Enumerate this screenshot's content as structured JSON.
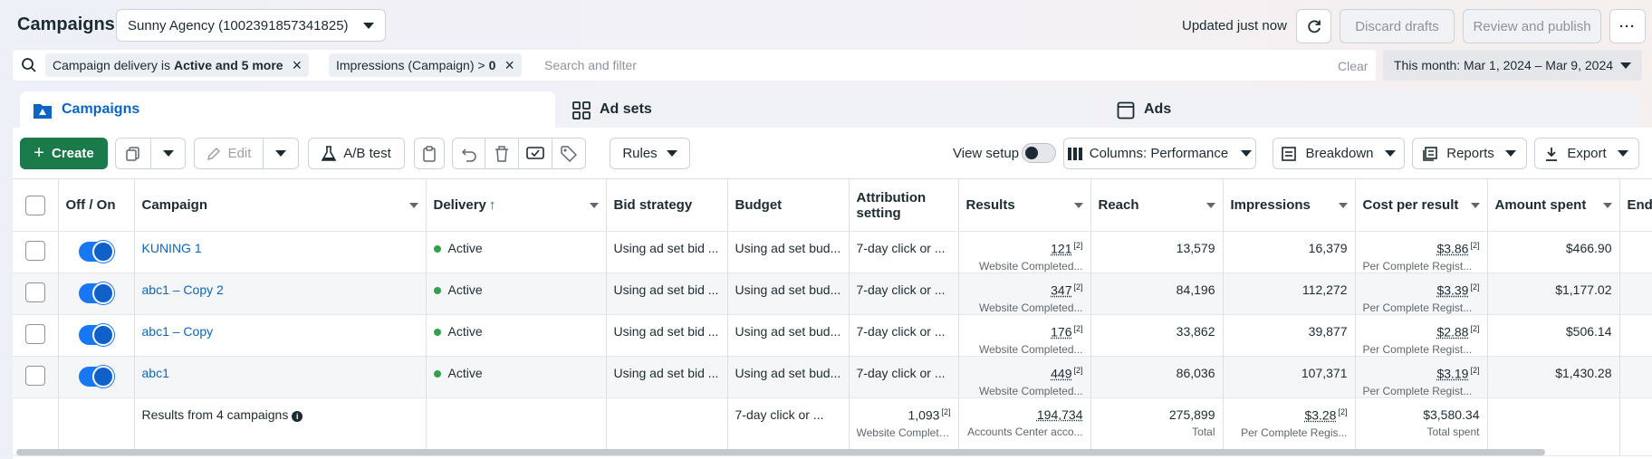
{
  "header": {
    "title": "Campaigns",
    "account": "Sunny Agency (1002391857341825)",
    "updated": "Updated just now",
    "discard": "Discard drafts",
    "review": "Review and publish",
    "more": "···"
  },
  "filters": {
    "chip1_prefix": "Campaign delivery is",
    "chip1_value": "Active and 5 more",
    "chip2_prefix": "Impressions (Campaign) >",
    "chip2_value": "0",
    "placeholder": "Search and filter",
    "clear": "Clear",
    "daterange": "This month: Mar 1, 2024 – Mar 9, 2024"
  },
  "tabs": [
    "Campaigns",
    "Ad sets",
    "Ads"
  ],
  "toolbar": {
    "create": "Create",
    "edit": "Edit",
    "abtest": "A/B test",
    "rules": "Rules",
    "view_setup": "View setup",
    "columns": "Columns: Performance",
    "breakdown": "Breakdown",
    "reports": "Reports",
    "export": "Export"
  },
  "columns": [
    "Off / On",
    "Campaign",
    "Delivery",
    "Bid strategy",
    "Budget",
    "Attribution setting",
    "Results",
    "Reach",
    "Impressions",
    "Cost per result",
    "Amount spent",
    "End"
  ],
  "rows": [
    {
      "name": "KUNING 1",
      "delivery": "Active",
      "bid": "Using ad set bid ...",
      "budget": "Using ad set bud...",
      "attribution": "7-day click or ...",
      "results": "121",
      "results_sub": "Website Completed...",
      "reach": "13,579",
      "impressions": "16,379",
      "cpr": "$3.86",
      "cpr_sub": "Per Complete Regist...",
      "spent": "$466.90"
    },
    {
      "name": "abc1 – Copy 2",
      "delivery": "Active",
      "bid": "Using ad set bid ...",
      "budget": "Using ad set bud...",
      "attribution": "7-day click or ...",
      "results": "347",
      "results_sub": "Website Completed...",
      "reach": "84,196",
      "impressions": "112,272",
      "cpr": "$3.39",
      "cpr_sub": "Per Complete Regist...",
      "spent": "$1,177.02"
    },
    {
      "name": "abc1 – Copy",
      "delivery": "Active",
      "bid": "Using ad set bid ...",
      "budget": "Using ad set bud...",
      "attribution": "7-day click or ...",
      "results": "176",
      "results_sub": "Website Completed...",
      "reach": "33,862",
      "impressions": "39,877",
      "cpr": "$2.88",
      "cpr_sub": "Per Complete Regist...",
      "spent": "$506.14"
    },
    {
      "name": "abc1",
      "delivery": "Active",
      "bid": "Using ad set bid ...",
      "budget": "Using ad set bud...",
      "attribution": "7-day click or ...",
      "results": "449",
      "results_sub": "Website Completed...",
      "reach": "86,036",
      "impressions": "107,371",
      "cpr": "$3.19",
      "cpr_sub": "Per Complete Regist...",
      "spent": "$1,430.28"
    }
  ],
  "totals": {
    "label": "Results from 4 campaigns",
    "attribution": "7-day click or ...",
    "results": "1,093",
    "results_sub": "Website Completed...",
    "reach": "194,734",
    "reach_sub": "Accounts Center acco...",
    "impressions": "275,899",
    "impressions_sub": "Total",
    "cpr": "$3.28",
    "cpr_sub": "Per Complete Regis...",
    "spent": "$3,580.34",
    "spent_sub": "Total spent"
  },
  "footnote_marker": "[2]",
  "colors": {
    "accent": "#0a66c2",
    "create": "#1a7a4a",
    "active_dot": "#31a24c",
    "toggle": "#1877f2"
  }
}
